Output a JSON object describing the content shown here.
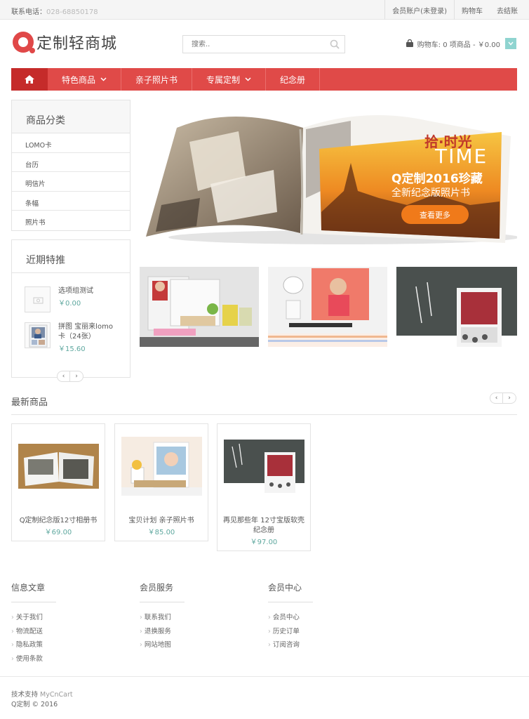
{
  "topbar": {
    "phone_label": "联系电话：",
    "phone_number": "028-68850178",
    "account": "会员账户(未登录)",
    "cart": "购物车",
    "checkout": "去结账"
  },
  "header": {
    "logo_text": "定制轻商城",
    "search_placeholder": "搜索..",
    "cart_summary": "购物车: 0 项商品 - ￥0.00"
  },
  "nav": {
    "items": [
      {
        "label": "特色商品",
        "has_dropdown": true
      },
      {
        "label": "亲子照片书",
        "has_dropdown": false
      },
      {
        "label": "专属定制",
        "has_dropdown": true
      },
      {
        "label": "纪念册",
        "has_dropdown": false
      }
    ]
  },
  "sidebar": {
    "categories_title": "商品分类",
    "categories": [
      "LOMO卡",
      "台历",
      "明信片",
      "条幅",
      "照片书"
    ],
    "specials_title": "近期特推",
    "specials": [
      {
        "name": "选项组测试",
        "price": "￥0.00"
      },
      {
        "name": "拼图 宝丽来lomo卡（24张）",
        "price": "￥15.60"
      }
    ]
  },
  "banner": {
    "headline_1": "拾·时光",
    "headline_en": "TIME",
    "headline_2": "Q定制2016珍藏",
    "headline_3": "全新纪念版照片书",
    "cta": "查看更多"
  },
  "latest": {
    "title": "最新商品",
    "products": [
      {
        "name": "Q定制纪念版12寸相册书",
        "price": "￥69.00"
      },
      {
        "name": "宝贝计划 亲子照片书",
        "price": "￥85.00"
      },
      {
        "name": "再见那些年 12寸宝版软壳纪念册",
        "price": "￥97.00"
      }
    ]
  },
  "footer": {
    "columns": [
      {
        "title": "信息文章",
        "links": [
          "关于我们",
          "物流配送",
          "隐私政策",
          "使用条款"
        ]
      },
      {
        "title": "会员服务",
        "links": [
          "联系我们",
          "退换服务",
          "网站地图"
        ]
      },
      {
        "title": "会员中心",
        "links": [
          "会员中心",
          "历史订单",
          "订阅咨询"
        ]
      }
    ],
    "powered_label": "技术支持 ",
    "powered_brand": "MyCnCart",
    "copyright": "Q定制 © 2016"
  },
  "colors": {
    "brand_red": "#e04a48",
    "nav_dark": "#c52b2a",
    "price_teal": "#5fa89f",
    "banner_orange": "#f07a1a"
  }
}
